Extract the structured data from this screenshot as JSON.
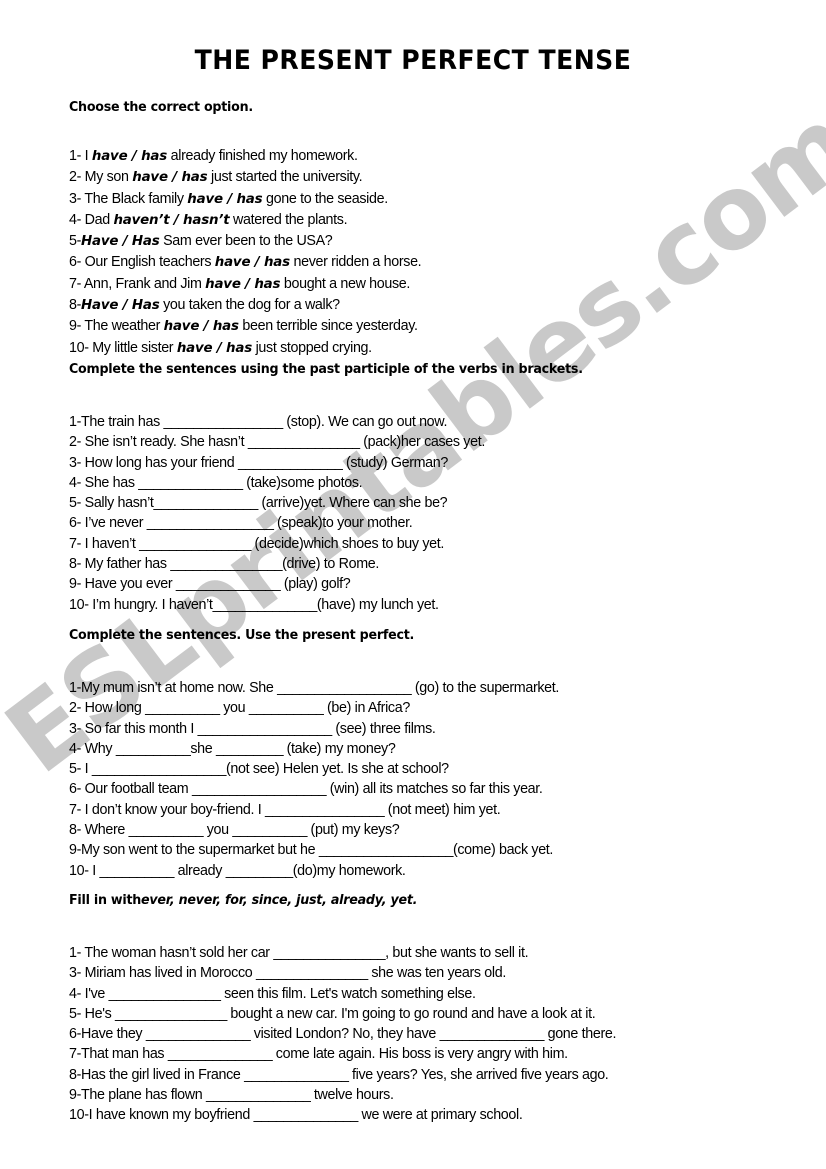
{
  "watermark": {
    "text": "ESLprintables.com",
    "color": "#c9c9c9"
  },
  "title": "THE PRESENT PERFECT TENSE",
  "sections": [
    {
      "heading_main": "Choose the correct option.",
      "heading_hint": "",
      "items": [
        {
          "pre": "1- I ",
          "bold": "have / has",
          "post": " already finished my homework."
        },
        {
          "pre": "2- My son ",
          "bold": "have / has",
          "post": " just started the university."
        },
        {
          "pre": "3- The Black family ",
          "bold": "have / has",
          "post": " gone to the seaside."
        },
        {
          "pre": "4- Dad ",
          "bold": "haven’t / hasn’t",
          "post": " watered the plants."
        },
        {
          "pre": "5-",
          "bold": "Have / Has",
          "post": " Sam ever been to the USA?"
        },
        {
          "pre": "6- Our English teachers ",
          "bold": "have / has",
          "post": " never ridden a horse."
        },
        {
          "pre": "7- Ann, Frank and Jim ",
          "bold": "have / has",
          "post": " bought a new house."
        },
        {
          "pre": "8-",
          "bold": "Have / Has",
          "post": " you taken the dog for a walk?"
        },
        {
          "pre": "9- The weather ",
          "bold": "have / has",
          "post": " been terrible since yesterday."
        },
        {
          "pre": "10- My little sister ",
          "bold": "have / has",
          "post": " just stopped crying."
        }
      ]
    },
    {
      "heading_main": "Complete the sentences using the past participle of the verbs in brackets.",
      "heading_hint": "",
      "items": [
        {
          "pre": "1-The train has ",
          "blank": "________________",
          "post": " (stop). We can go out now."
        },
        {
          "pre": "2- She isn’t ready. She hasn’t ",
          "blank": "_______________",
          "post": " (pack)her cases yet."
        },
        {
          "pre": "3- How long has your friend ",
          "blank": "______________",
          "post": " (study) German?"
        },
        {
          "pre": "4- She has ",
          "blank": "______________",
          "post": " (take)some photos."
        },
        {
          "pre": "5- Sally hasn’t",
          "blank": "______________",
          "post": " (arrive)yet. Where can she be?"
        },
        {
          "pre": "6- I’ve never ",
          "blank": "_________________",
          "post": " (speak)to your mother."
        },
        {
          "pre": "7- I haven’t ",
          "blank": "_______________",
          "post": " (decide)which shoes to buy yet."
        },
        {
          "pre": "8- My father has ",
          "blank": "_______________",
          "post": "(drive) to Rome."
        },
        {
          "pre": "9- Have you ever ",
          "blank": "______________",
          "post": " (play) golf?"
        },
        {
          "pre": "10- I’m hungry. I haven’t",
          "blank": "______________",
          "post": "(have) my lunch yet."
        }
      ]
    },
    {
      "heading_main": "Complete the sentences. Use the present perfect.",
      "heading_hint": "",
      "items": [
        {
          "pre": "1-My mum isn’t at home now. She ",
          "blank": "__________________",
          "post": " (go) to the supermarket."
        },
        {
          "pre": "2- How long ",
          "blank": "__________",
          "mid": " you ",
          "blank2": "__________",
          "post": " (be) in Africa?"
        },
        {
          "pre": "3- So far this month I ",
          "blank": "__________________",
          "post": " (see) three films."
        },
        {
          "pre": "4- Why ",
          "blank": "__________",
          "mid": "she ",
          "blank2": "_________",
          "post": " (take) my money?"
        },
        {
          "pre": "5- I ",
          "blank": "__________________",
          "post": "(not see) Helen yet. Is she at school?"
        },
        {
          "pre": "6- Our football team ",
          "blank": "__________________",
          "post": " (win) all its matches so far this year."
        },
        {
          "pre": "7- I don’t know your boy-friend. I ",
          "blank": "________________",
          "post": " (not meet) him yet."
        },
        {
          "pre": "8- Where ",
          "blank": "__________",
          "mid": " you ",
          "blank2": "__________",
          "post": " (put) my keys?"
        },
        {
          "pre": "9-My son went to the supermarket but he ",
          "blank": "__________________",
          "post": "(come) back yet."
        },
        {
          "pre": "10- I ",
          "blank": "__________",
          "mid": " already ",
          "blank2": "_________",
          "post": "(do)my homework."
        }
      ]
    },
    {
      "heading_main": "Fill in with",
      "heading_hint": "ever, never, for, since, just, already, yet.",
      "items": [
        {
          "pre": "1- The woman hasn’t sold her car ",
          "blank": "_______________",
          "post": ", but she wants to sell it."
        },
        {
          "pre": "3- Miriam has lived in Morocco ",
          "blank": "_______________",
          "post": " she was ten years old."
        },
        {
          "pre": "4- I've ",
          "blank": "_______________",
          "post": " seen this film. Let's watch something else."
        },
        {
          "pre": "5- He's ",
          "blank": "_______________",
          "post": " bought a new car. I'm going to go round and have a look at it."
        },
        {
          "pre": "6-Have they ",
          "blank": "______________",
          "mid": " visited London? No, they have ",
          "blank2": "______________",
          "post": " gone there."
        },
        {
          "pre": "7-That man has ",
          "blank": "______________",
          "post": " come late again. His boss is very angry with him."
        },
        {
          "pre": "8-Has the girl lived in France ",
          "blank": "______________",
          "post": " five years? Yes, she arrived five years ago."
        },
        {
          "pre": "9-The plane has flown ",
          "blank": "______________",
          "post": " twelve hours."
        },
        {
          "pre": "10-I have known my boyfriend ",
          "blank": "______________",
          "post": " we were at primary school."
        }
      ]
    }
  ]
}
